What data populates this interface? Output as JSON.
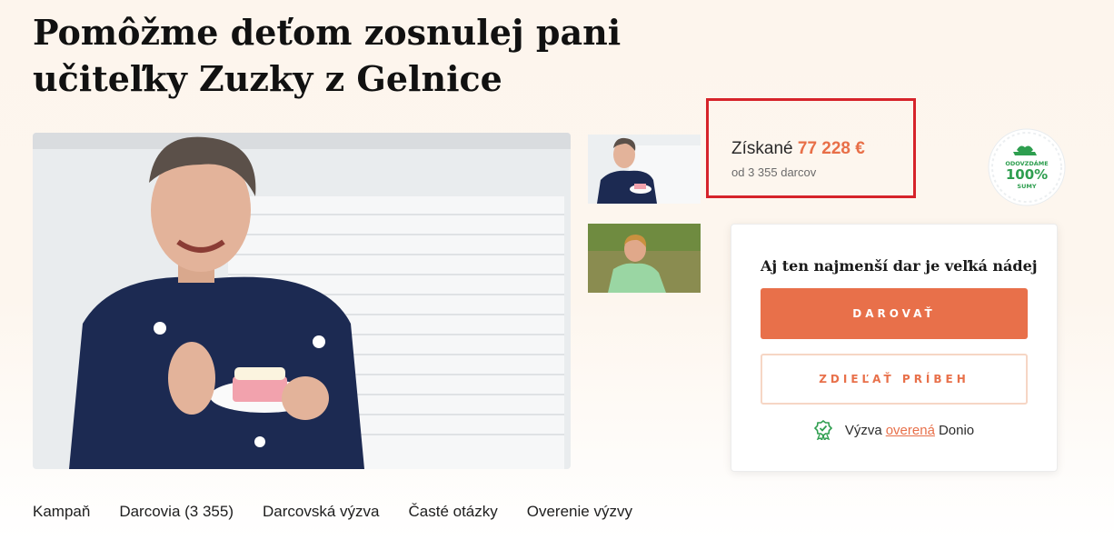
{
  "campaign": {
    "title": "Pomôžme deťom zosnulej pani učiteľky Zuzky z Gelnice"
  },
  "media": {
    "main_photo": "woman-with-cake-photo",
    "thumbnails": [
      "woman-with-cake-thumbnail",
      "woman-by-lake-thumbnail"
    ]
  },
  "stats": {
    "raised_label": "Získané",
    "raised_amount": "77 228 €",
    "donors_text": "od 3 355 darcov"
  },
  "badge": {
    "top_text": "ODOVZDÁME",
    "percent": "100%",
    "bottom_text": "SUMY",
    "icon": "hand-heart-icon"
  },
  "donate_card": {
    "heading": "Aj ten najmenší dar je veľká nádej",
    "donate_label": "DAROVAŤ",
    "share_label": "ZDIEĽAŤ PRÍBEH",
    "verified_prefix": "Výzva",
    "verified_link": "overená",
    "verified_suffix": "Donio",
    "verified_icon": "verified-badge-icon"
  },
  "tabs": [
    "Kampaň",
    "Darcovia (3 355)",
    "Darcovská výzva",
    "Časté otázky",
    "Overenie výzvy"
  ],
  "colors": {
    "accent": "#e8704a",
    "highlight_border": "#d6232a",
    "verified_green": "#2e9e4f",
    "background": "#fdf5ed"
  }
}
